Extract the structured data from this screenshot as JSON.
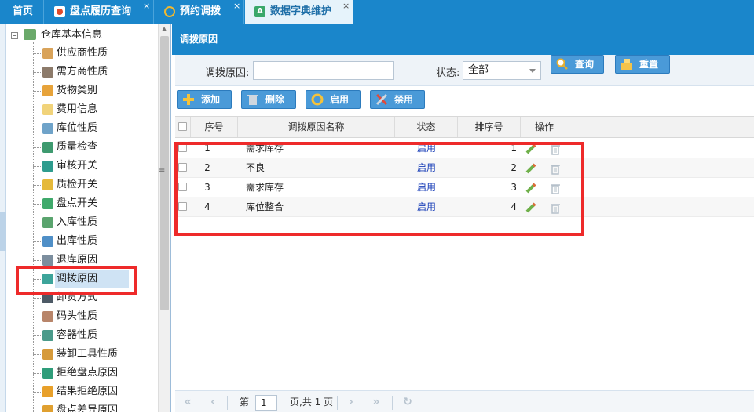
{
  "tabs": [
    {
      "label": "首页",
      "close": ""
    },
    {
      "label": "盘点履历查询",
      "close": "×"
    },
    {
      "label": "预约调拨",
      "close": "×"
    },
    {
      "label": "数据字典维护",
      "close": "×"
    }
  ],
  "tree": {
    "root_toggle": "−",
    "root": "仓库基本信息",
    "items": [
      {
        "label": "供应商性质",
        "icon": "user-icon",
        "color": "#d9a35a"
      },
      {
        "label": "需方商性质",
        "icon": "user-icon",
        "color": "#8c7a6a"
      },
      {
        "label": "货物类别",
        "icon": "blocks-icon",
        "color": "#e7a33a"
      },
      {
        "label": "费用信息",
        "icon": "note-icon",
        "color": "#f1d37a"
      },
      {
        "label": "库位性质",
        "icon": "box-icon",
        "color": "#6fa3c9"
      },
      {
        "label": "质量检查",
        "icon": "check-icon",
        "color": "#3e9a6f"
      },
      {
        "label": "审核开关",
        "icon": "switch-icon",
        "color": "#2e9c8e"
      },
      {
        "label": "质检开关",
        "icon": "switch-icon",
        "color": "#e5b93a"
      },
      {
        "label": "盘点开关",
        "icon": "switch-icon",
        "color": "#3fa96b"
      },
      {
        "label": "入库性质",
        "icon": "inbound-icon",
        "color": "#5aa46e"
      },
      {
        "label": "出库性质",
        "icon": "outbound-icon",
        "color": "#4f8fc7"
      },
      {
        "label": "退库原因",
        "icon": "return-icon",
        "color": "#7c8e9e"
      },
      {
        "label": "调拨原因",
        "icon": "transfer-icon",
        "color": "#3da49a"
      },
      {
        "label": "卸货方式",
        "icon": "truck-icon",
        "color": "#4d5a66"
      },
      {
        "label": "码头性质",
        "icon": "dock-icon",
        "color": "#b8856a"
      },
      {
        "label": "容器性质",
        "icon": "container-icon",
        "color": "#4a9a8a"
      },
      {
        "label": "装卸工具性质",
        "icon": "tool-icon",
        "color": "#d69a3a"
      },
      {
        "label": "拒绝盘点原因",
        "icon": "circle-icon",
        "color": "#2f9d7a"
      },
      {
        "label": "结果拒绝原因",
        "icon": "circle-icon",
        "color": "#e8a02a"
      },
      {
        "label": "盘点差异原因",
        "icon": "circle-icon",
        "color": "#e0a030"
      }
    ],
    "selected": "调拨原因"
  },
  "panel": {
    "title": "调拨原因"
  },
  "search": {
    "reason_label": "调拨原因:",
    "reason_value": "",
    "status_label": "状态:",
    "status_value": "全部",
    "query_label": "查询",
    "reset_label": "重置"
  },
  "toolbar": {
    "add_label": "添加",
    "delete_label": "删除",
    "enable_label": "启用",
    "disable_label": "禁用"
  },
  "grid": {
    "headers": {
      "no": "序号",
      "name": "调拨原因名称",
      "status": "状态",
      "sort": "排序号",
      "ops": "操作"
    },
    "rows": [
      {
        "no": "1",
        "name": "需求库存",
        "status": "启用",
        "sort": "1"
      },
      {
        "no": "2",
        "name": "不良",
        "status": "启用",
        "sort": "2"
      },
      {
        "no": "3",
        "name": "需求库存",
        "status": "启用",
        "sort": "3"
      },
      {
        "no": "4",
        "name": "库位整合",
        "status": "启用",
        "sort": "4"
      }
    ]
  },
  "pager": {
    "page_prefix": "第",
    "page_value": "1",
    "page_suffix": "页,共 1 页"
  },
  "colors": {
    "brand_blue": "#1a86cb",
    "annotation_red": "#ee2a2a",
    "status_link": "#1a3fb8"
  }
}
